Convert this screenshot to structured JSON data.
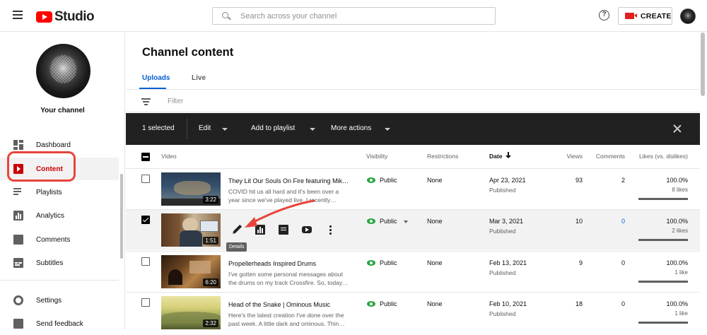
{
  "header": {
    "app_name": "Studio",
    "search_placeholder": "Search across your channel",
    "help": "?",
    "create_label": "CREATE"
  },
  "sidebar": {
    "channel_label": "Your channel",
    "items": [
      {
        "label": "Dashboard",
        "icon": "dashboard-icon"
      },
      {
        "label": "Content",
        "icon": "content-icon",
        "active": true
      },
      {
        "label": "Playlists",
        "icon": "playlists-icon"
      },
      {
        "label": "Analytics",
        "icon": "analytics-icon"
      },
      {
        "label": "Comments",
        "icon": "comments-icon"
      },
      {
        "label": "Subtitles",
        "icon": "subtitles-icon"
      },
      {
        "label": "Settings",
        "icon": "settings-icon"
      },
      {
        "label": "Send feedback",
        "icon": "feedback-icon"
      }
    ]
  },
  "main": {
    "title": "Channel content",
    "tabs": [
      {
        "label": "Uploads",
        "active": true
      },
      {
        "label": "Live"
      }
    ],
    "filter_placeholder": "Filter",
    "action_bar": {
      "selected": "1 selected",
      "edit": "Edit",
      "add_to_playlist": "Add to playlist",
      "more_actions": "More actions"
    },
    "columns": {
      "video": "Video",
      "visibility": "Visibility",
      "restrictions": "Restrictions",
      "date": "Date",
      "views": "Views",
      "comments": "Comments",
      "likes": "Likes (vs. dislikes)"
    },
    "tooltip": "Details",
    "rows": [
      {
        "title": "They Lit Our Souls On Fire featuring Mik…",
        "description": "COVID hit us all hard and it's been over a year since we've played live. I recently…",
        "duration": "3:22",
        "visibility": "Public",
        "restrictions": "None",
        "date": "Apr 23, 2021",
        "status": "Published",
        "views": "93",
        "comments": "2",
        "likes_pct": "100.0%",
        "likes_count": "8 likes",
        "likes_fraction": 1.0,
        "selected": false
      },
      {
        "title": "",
        "description": "",
        "duration": "1:51",
        "visibility": "Public",
        "restrictions": "None",
        "date": "Mar 3, 2021",
        "status": "Published",
        "views": "10",
        "comments": "0",
        "likes_pct": "100.0%",
        "likes_count": "2 likes",
        "likes_fraction": 1.0,
        "selected": true
      },
      {
        "title": "Propellerheads Inspired Drums",
        "description": "I've gotten some personal messages about the drums on my track Crossfire. So, today…",
        "duration": "6:20",
        "visibility": "Public",
        "restrictions": "None",
        "date": "Feb 13, 2021",
        "status": "Published",
        "views": "9",
        "comments": "0",
        "likes_pct": "100.0%",
        "likes_count": "1 like",
        "likes_fraction": 1.0,
        "selected": false
      },
      {
        "title": "Head of the Snake | Ominous Music",
        "description": "Here's the latest creation I've done over the past week. A little dark and ominous. Thin…",
        "duration": "2:32",
        "visibility": "Public",
        "restrictions": "None",
        "date": "Feb 10, 2021",
        "status": "Published",
        "views": "18",
        "comments": "0",
        "likes_pct": "100.0%",
        "likes_count": "1 like",
        "likes_fraction": 1.0,
        "selected": false
      }
    ]
  },
  "colors": {
    "brand_red": "#ff0000",
    "active_red": "#cc0000",
    "link_blue": "#065fd4",
    "public_green": "#2ba640",
    "annotation_red": "#e8453c"
  }
}
